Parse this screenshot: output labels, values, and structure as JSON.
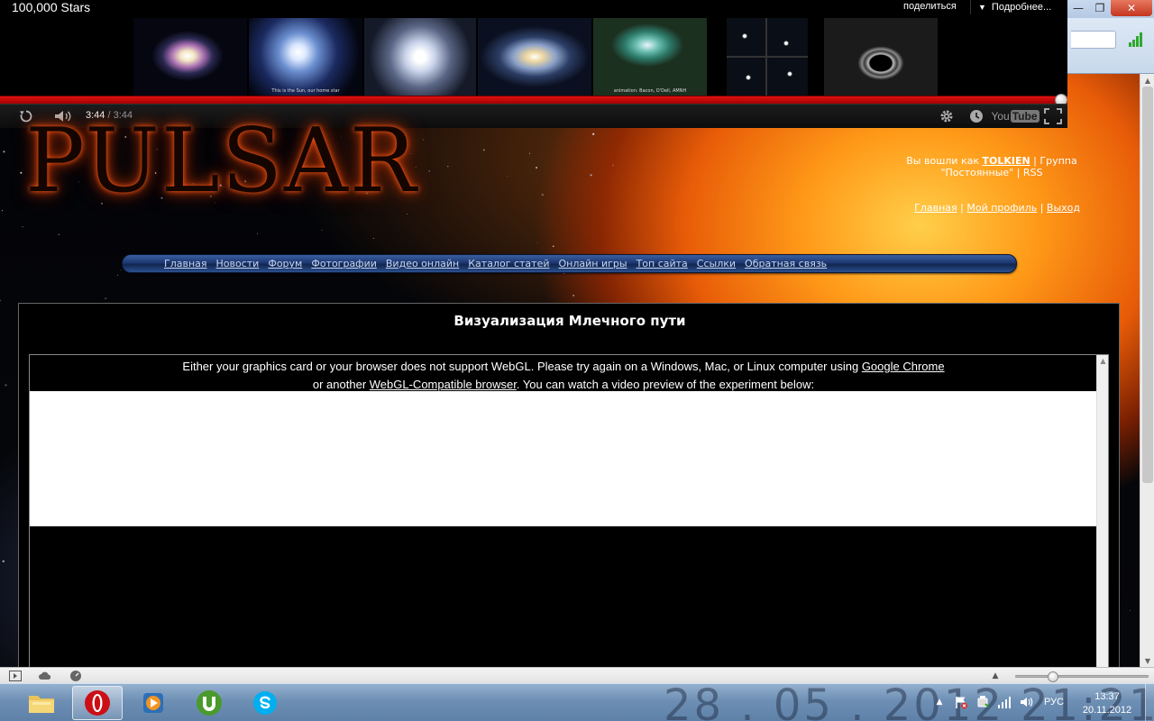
{
  "video": {
    "title": "100,000 Stars",
    "share_label": "поделиться",
    "more_label": "Подробнее...",
    "thumbnail_caption_2": "This is the Sun, our home star",
    "thumbnail_caption_5": "animation: Bacon, O'Dell, AMNH",
    "progress": 1.0,
    "current_time": "3:44",
    "separator": " / ",
    "total_time": "3:44",
    "youtube_logo_you": "You",
    "youtube_logo_tube": "Tube"
  },
  "site": {
    "logo_text": "PULSAR",
    "user_prefix": "Вы вошли как ",
    "user_name": "TOLKIEN",
    "group_prefix": " | Группа",
    "group_name": "Постоянные",
    "rss_label": "RSS",
    "link_home": "Главная",
    "link_profile": "Мой профиль",
    "link_logout": "Выход"
  },
  "nav": {
    "items": [
      "Главная",
      "Новости",
      "Форум",
      "Фотографии",
      "Видео онлайн",
      "Каталог статей",
      "Онлайн игры",
      "Топ сайта",
      "Ссылки",
      "Обратная связь"
    ]
  },
  "content": {
    "title": "Визуализация Млечного пути",
    "message_part1": "Either your graphics card or your browser does not support WebGL. Please try again on a Windows, Mac, or Linux computer using ",
    "chrome_link": "Google Chrome",
    "message_part2": "or another ",
    "webgl_link": "WebGL-Compatible browser",
    "message_part3": ". You can watch a video preview of the experiment below:"
  },
  "statusbar": {
    "zoom_level": 0.28
  },
  "taskbar": {
    "watermark": "28 . 05 . 2012   21:21",
    "language": "РУС",
    "time": "13:37",
    "date": "20.11.2012",
    "apps": [
      "explorer",
      "opera",
      "media-player",
      "utorrent",
      "skype"
    ],
    "active_app": "opera"
  },
  "colors": {
    "progress_red": "#cc0000",
    "nav_blue": "#1d3872",
    "opera_red": "#cc0f16",
    "utorrent_green": "#4a9a2c",
    "skype_blue": "#00aff0"
  }
}
